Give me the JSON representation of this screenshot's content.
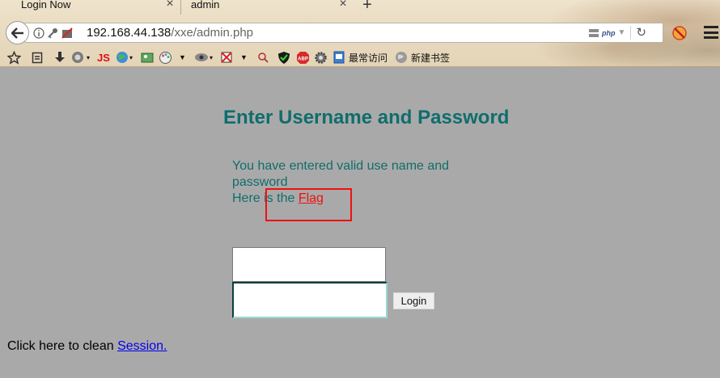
{
  "browser": {
    "tabs": [
      {
        "label": "Login Now"
      },
      {
        "label": "admin"
      }
    ],
    "url": {
      "host": "192.168.44.138",
      "path": "/xxe/admin.php"
    },
    "php_badge": "php",
    "bookmarks": {
      "js_label": "JS",
      "abp_label": "ABP",
      "most_visited": "最常访问",
      "new_bookmark": "新建书签"
    },
    "icons": [
      "back-arrow-icon",
      "info-icon",
      "key-icon",
      "no-flash-icon",
      "star-icon",
      "clipboard-icon",
      "download-icon",
      "globe-icon",
      "reload-icon",
      "menu-icon"
    ]
  },
  "page": {
    "title": "Enter Username and Password",
    "message_line1": "You have entered valid use name and password",
    "message_prefix": "Here is the ",
    "flag_link": "Flag",
    "username_value": "",
    "password_value": "",
    "login_label": "Login",
    "session_prefix": "Click here to clean ",
    "session_link": "Session."
  },
  "colors": {
    "page_bg": "#aaa9a9",
    "heading": "#106d6d",
    "flag_link": "#ee1111",
    "highlight": "#ee1111",
    "session_link": "#0000ee"
  }
}
